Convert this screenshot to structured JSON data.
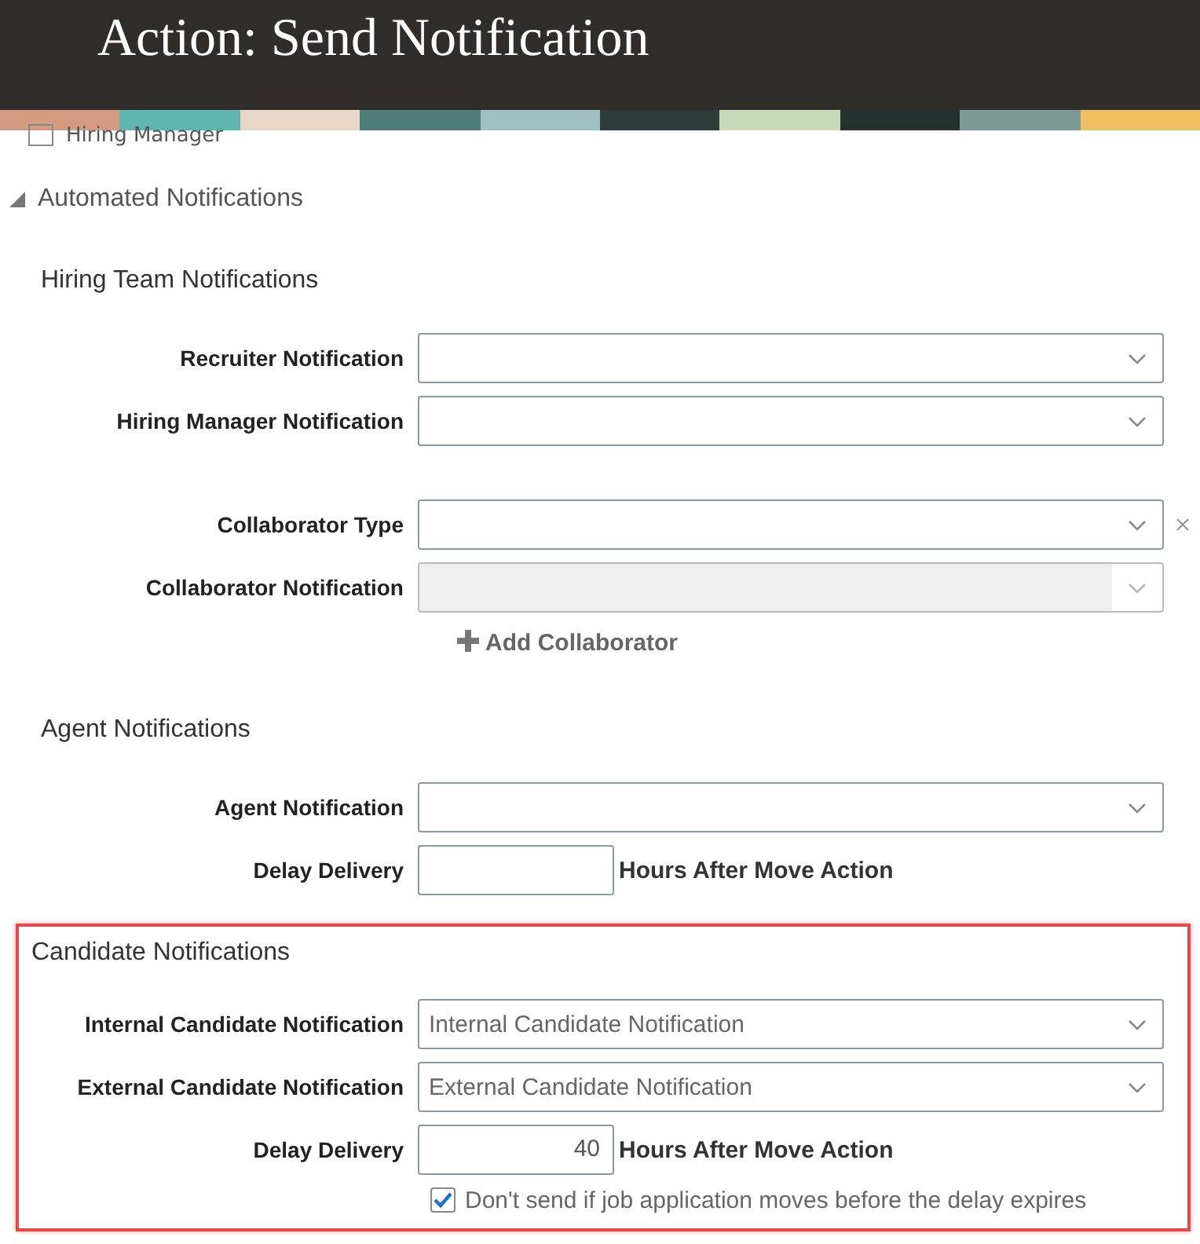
{
  "header": {
    "title": "Action: Send Notification"
  },
  "hiring_manager": {
    "label": "Hiring Manager",
    "checked": false
  },
  "section": {
    "title": "Automated Notifications",
    "expanded": true
  },
  "groups": [
    {
      "title": "Hiring Team Notifications",
      "highlighted": false,
      "fields": [
        {
          "kind": "select",
          "label": "Recruiter Notification",
          "disabled": false,
          "clearable": false
        },
        {
          "kind": "select",
          "label": "Hiring Manager Notification",
          "disabled": false,
          "clearable": false
        },
        {
          "kind": "spacer"
        },
        {
          "kind": "select",
          "label": "Collaborator Type",
          "disabled": false,
          "clearable": true
        },
        {
          "kind": "select",
          "label": "Collaborator Notification",
          "disabled": true,
          "clearable": false
        },
        {
          "kind": "link",
          "label": "Add Collaborator"
        }
      ]
    },
    {
      "title": "Agent Notifications",
      "highlighted": false,
      "fields": [
        {
          "kind": "select",
          "label": "Agent Notification",
          "disabled": false,
          "clearable": false
        },
        {
          "kind": "number",
          "label": "Delay Delivery",
          "suffix": "Hours After Move Action"
        }
      ]
    },
    {
      "title": "Candidate Notifications",
      "highlighted": true,
      "fields": [
        {
          "kind": "spacer"
        },
        {
          "kind": "select",
          "label": "Internal Candidate Notification",
          "value": "Internal Candidate Notification",
          "disabled": false,
          "clearable": false
        },
        {
          "kind": "select",
          "label": "External Candidate Notification",
          "value": "External Candidate Notification",
          "disabled": false,
          "clearable": false
        },
        {
          "kind": "number",
          "label": "Delay Delivery",
          "value": "40",
          "suffix": "Hours After Move Action"
        },
        {
          "kind": "checkbox",
          "label": "Don't send if job application moves before the delay expires",
          "checked": true
        }
      ]
    }
  ]
}
